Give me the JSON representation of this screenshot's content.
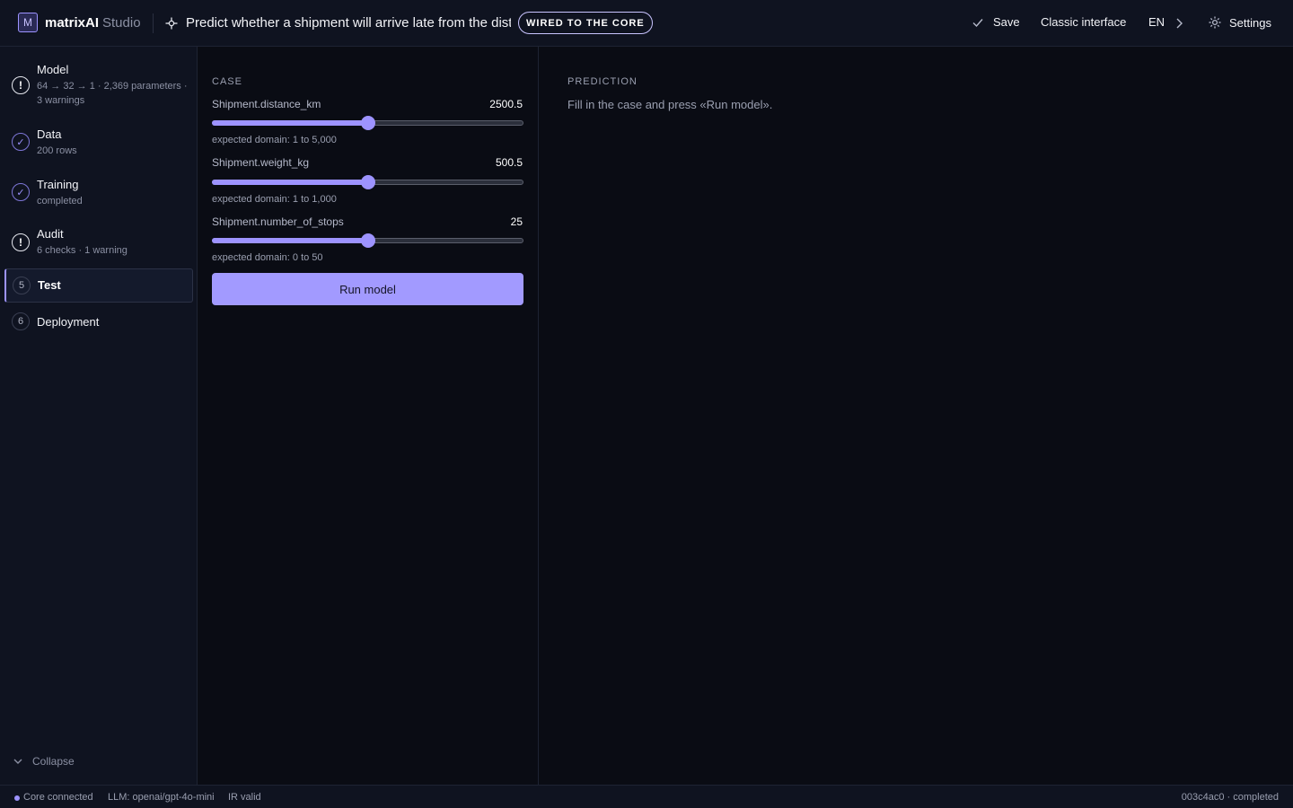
{
  "header": {
    "logo_letter": "M",
    "brand": "matrixAI",
    "brand_sub": "Studio",
    "project_title": "Predict whether a shipment will arrive late from the distanc",
    "badge": "WIRED TO THE CORE",
    "save_label": "Save",
    "classic_label": "Classic interface",
    "lang_label": "EN",
    "settings_label": "Settings"
  },
  "sidebar": {
    "steps": [
      {
        "indicator": "!",
        "status": "warning",
        "title": "Model",
        "subtitle": "64 → 32 → 1 · 2,369 parameters · 3 warnings"
      },
      {
        "indicator": "✓",
        "status": "done",
        "title": "Data",
        "subtitle": "200 rows"
      },
      {
        "indicator": "✓",
        "status": "done",
        "title": "Training",
        "subtitle": "completed"
      },
      {
        "indicator": "!",
        "status": "warning",
        "title": "Audit",
        "subtitle": "6 checks · 1 warning"
      },
      {
        "indicator": "5",
        "status": "active",
        "title": "Test",
        "subtitle": ""
      },
      {
        "indicator": "6",
        "status": "pending",
        "title": "Deployment",
        "subtitle": ""
      }
    ],
    "collapse_label": "Collapse"
  },
  "case": {
    "section_label": "CASE",
    "fields": [
      {
        "label": "Shipment.distance_km",
        "value": "2500.5",
        "level": 0.5,
        "hint": "expected domain: 1 to 5,000"
      },
      {
        "label": "Shipment.weight_kg",
        "value": "500.5",
        "level": 0.5,
        "hint": "expected domain: 1 to 1,000"
      },
      {
        "label": "Shipment.number_of_stops",
        "value": "25",
        "level": 0.5,
        "hint": "expected domain: 0 to 50"
      }
    ],
    "run_label": "Run model"
  },
  "prediction": {
    "section_label": "PREDICTION",
    "placeholder": "Fill in the case and press «Run model»."
  },
  "status": {
    "core": "Core connected",
    "llm": "LLM: openai/gpt-4o-mini",
    "ir": "IR valid",
    "run": "003c4ac0 · completed"
  },
  "colors": {
    "accent": "#9d93ff",
    "background": "#0a0c14",
    "panel": "#0f1320"
  }
}
